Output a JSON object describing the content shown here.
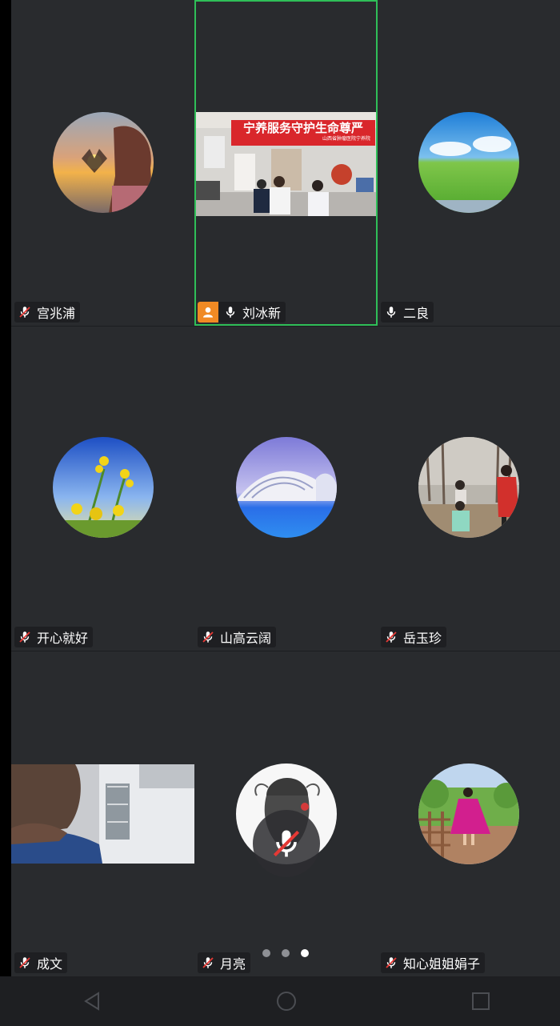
{
  "participants": [
    {
      "name": "宫兆浦",
      "mic": "muted"
    },
    {
      "name": "刘冰新",
      "mic": "on",
      "host": true,
      "video": true
    },
    {
      "name": "二良",
      "mic": "on"
    },
    {
      "name": "开心就好",
      "mic": "muted"
    },
    {
      "name": "山高云阔",
      "mic": "muted"
    },
    {
      "name": "岳玉珍",
      "mic": "muted"
    },
    {
      "name": "成文",
      "mic": "muted",
      "video": true
    },
    {
      "name": "月亮",
      "mic": "muted"
    },
    {
      "name": "知心姐姐娟子",
      "mic": "muted"
    }
  ],
  "video_banner": {
    "title": "宁养服务守护生命尊严",
    "subtitle": "山西省肿瘤医院宁养院"
  },
  "pagination": {
    "total": 3,
    "current": 3
  },
  "colors": {
    "active_border": "#2fbf58",
    "host_badge": "#f08a24",
    "muted_red": "#e53935",
    "tile_bg": "#292b2e"
  },
  "icons": {
    "muted": "mic-muted-icon",
    "on": "mic-icon",
    "host": "person-icon",
    "nav": [
      "back-icon",
      "home-icon",
      "recents-icon"
    ]
  }
}
